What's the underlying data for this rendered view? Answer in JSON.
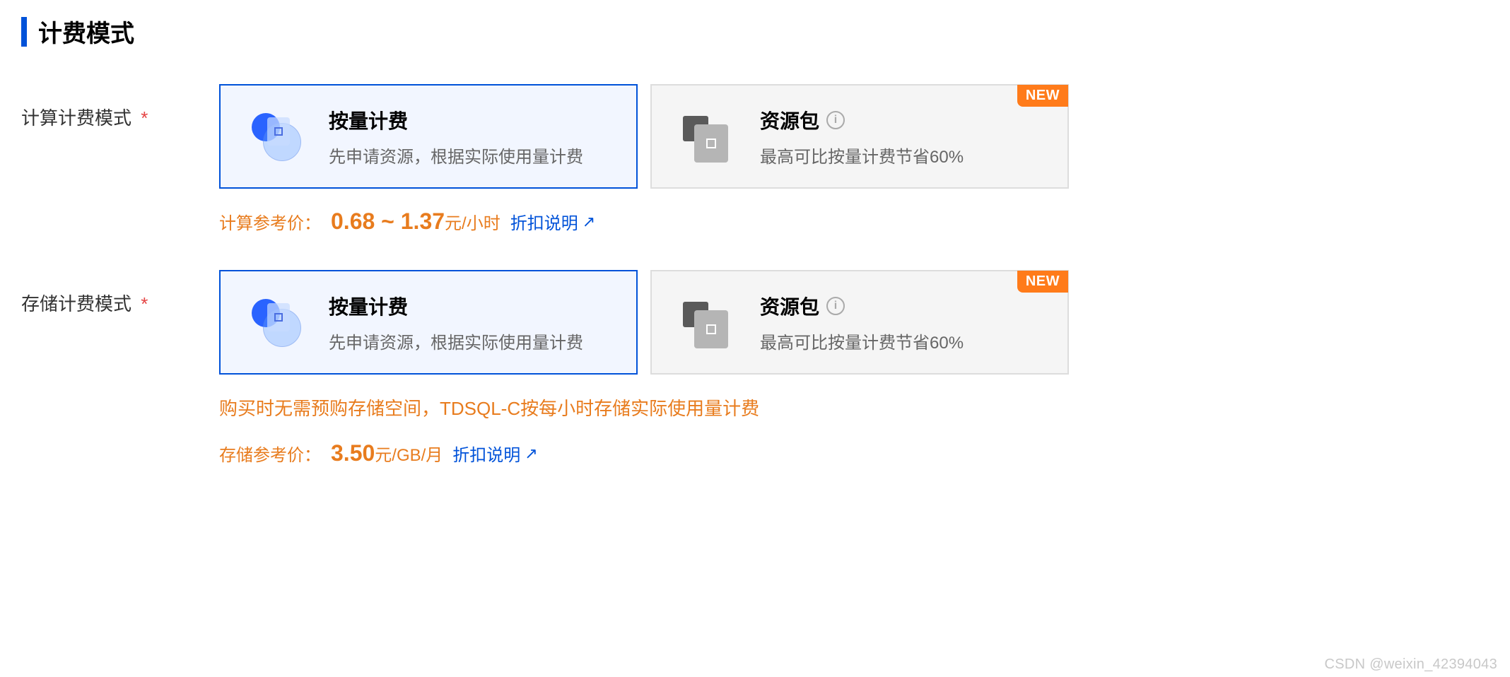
{
  "section": {
    "title": "计费模式"
  },
  "compute": {
    "label": "计算计费模式",
    "required": "*",
    "options": [
      {
        "title": "按量计费",
        "desc": "先申请资源，根据实际使用量计费",
        "selected": true,
        "new": false,
        "info": false
      },
      {
        "title": "资源包",
        "desc": "最高可比按量计费节省60%",
        "selected": false,
        "new": true,
        "info": true
      }
    ],
    "price": {
      "label": "计算参考价：",
      "value": "0.68 ~ 1.37",
      "unit": "元/小时",
      "discount_link": "折扣说明"
    }
  },
  "storage": {
    "label": "存储计费模式",
    "required": "*",
    "options": [
      {
        "title": "按量计费",
        "desc": "先申请资源，根据实际使用量计费",
        "selected": true,
        "new": false,
        "info": false
      },
      {
        "title": "资源包",
        "desc": "最高可比按量计费节省60%",
        "selected": false,
        "new": true,
        "info": true
      }
    ],
    "note": "购买时无需预购存储空间，TDSQL-C按每小时存储实际使用量计费",
    "price": {
      "label": "存储参考价：",
      "value": "3.50",
      "unit": "元/GB/月",
      "discount_link": "折扣说明"
    }
  },
  "badges": {
    "new": "NEW"
  },
  "watermark": "CSDN @weixin_42394043"
}
